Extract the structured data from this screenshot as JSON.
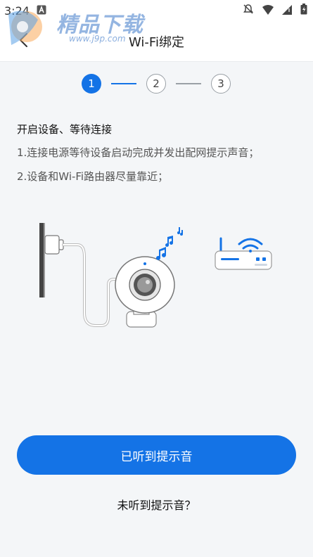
{
  "status_bar": {
    "time": "3:24",
    "icons": [
      "notification-app-icon",
      "mute-bell-icon",
      "wifi-icon",
      "cellular-signal-icon",
      "battery-icon"
    ]
  },
  "header": {
    "title": "Wi-Fi绑定",
    "back_icon": "chevron-left-icon"
  },
  "watermark": {
    "text": "精品下载",
    "url": "www.j9p.com"
  },
  "stepper": {
    "steps": [
      "1",
      "2",
      "3"
    ],
    "current": 1,
    "accent_color": "#1473e6"
  },
  "instructions": {
    "title": "开启设备、等待连接",
    "lines": [
      "1.连接电源等待设备启动完成并发出配网提示声音；",
      "2.设备和Wi-Fi路由器尽量靠近；"
    ]
  },
  "illustration": {
    "items": [
      "wall-outlet",
      "power-cable",
      "camera",
      "music-notes",
      "router",
      "wifi-signal"
    ]
  },
  "actions": {
    "primary_label": "已听到提示音",
    "secondary_label": "未听到提示音？"
  }
}
